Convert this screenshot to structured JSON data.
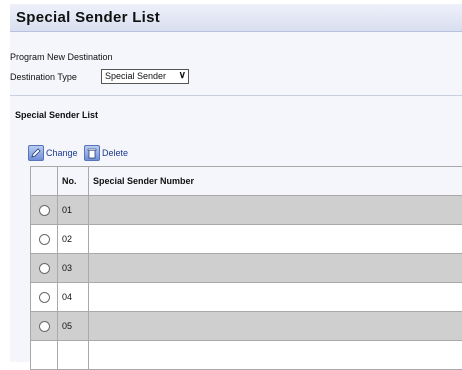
{
  "page": {
    "title": "Special Sender List"
  },
  "form": {
    "program_label": "Program New Destination",
    "dest_type_label": "Destination Type",
    "dest_type_value": "Special Sender"
  },
  "section": {
    "title": "Special Sender List"
  },
  "toolbar": {
    "change_label": "Change",
    "delete_label": "Delete"
  },
  "table": {
    "headers": [
      "",
      "No.",
      "Special Sender Number"
    ],
    "rows": [
      {
        "no": "01",
        "number": ""
      },
      {
        "no": "02",
        "number": ""
      },
      {
        "no": "03",
        "number": ""
      },
      {
        "no": "04",
        "number": ""
      },
      {
        "no": "05",
        "number": ""
      },
      {
        "no": "",
        "number": ""
      }
    ]
  },
  "colors": {
    "title_bg": "#dde3f2",
    "shaded_row": "#cfcfcf",
    "link_blue": "#1a3a8c"
  }
}
